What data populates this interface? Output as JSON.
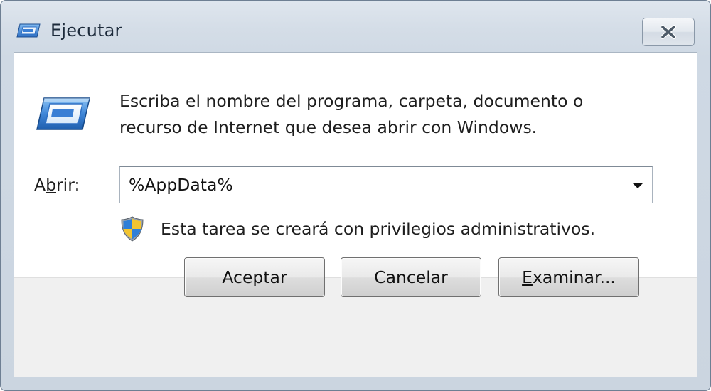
{
  "window": {
    "title": "Ejecutar"
  },
  "dialog": {
    "description_line1": "Escriba el nombre del programa, carpeta, documento o",
    "description_line2": "recurso de Internet que desea abrir con Windows.",
    "open_label_prefix": "A",
    "open_label_mnemonic": "b",
    "open_label_suffix": "rir:",
    "combo_value": "%AppData%",
    "admin_note": "Esta tarea se creará con privilegios administrativos."
  },
  "buttons": {
    "ok": "Aceptar",
    "cancel": "Cancelar",
    "browse_mnemonic": "E",
    "browse_rest": "xaminar..."
  },
  "icons": {
    "title_icon": "run-icon",
    "main_icon": "run-icon",
    "close_icon": "close-icon",
    "shield_icon": "uac-shield-icon",
    "dropdown_icon": "chevron-down-icon"
  },
  "colors": {
    "frame": "#cbd5e0",
    "client_bg": "#ffffff",
    "footer_bg": "#f0f0f0",
    "run_icon_blue": "#3a7fd5"
  }
}
